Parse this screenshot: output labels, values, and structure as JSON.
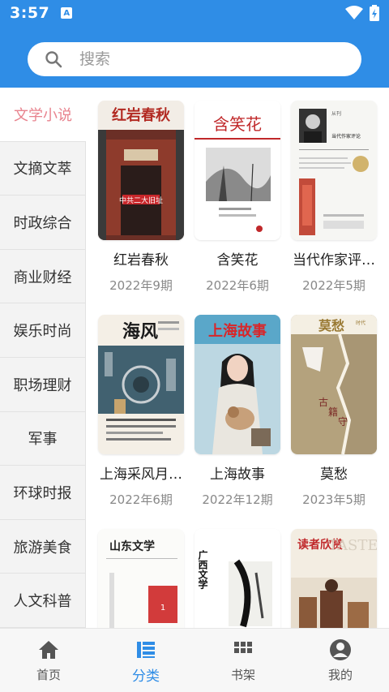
{
  "status": {
    "time": "3:57",
    "app_badge": "A"
  },
  "search": {
    "placeholder": "搜索"
  },
  "sidebar": {
    "items": [
      {
        "label": "文学小说",
        "active": true
      },
      {
        "label": "文摘文萃"
      },
      {
        "label": "时政综合"
      },
      {
        "label": "商业财经"
      },
      {
        "label": "娱乐时尚"
      },
      {
        "label": "职场理财"
      },
      {
        "label": "军事"
      },
      {
        "label": "环球时报"
      },
      {
        "label": "旅游美食"
      },
      {
        "label": "人文科普"
      }
    ]
  },
  "magazines": [
    {
      "title": "红岩春秋",
      "date": "2022年9期",
      "cover_heading": "红岩春秋",
      "cover_caption": "中共二大旧址"
    },
    {
      "title": "含笑花",
      "date": "2022年6期",
      "cover_heading": "含笑花"
    },
    {
      "title": "当代作家评…",
      "date": "2022年5期",
      "cover_heading": "当代作家评论"
    },
    {
      "title": "上海采风月…",
      "date": "2022年6期",
      "cover_heading": "海风"
    },
    {
      "title": "上海故事",
      "date": "2022年12期",
      "cover_heading": "上海故事"
    },
    {
      "title": "莫愁",
      "date": "2023年5期",
      "cover_heading": "莫愁"
    },
    {
      "title": "山东文学",
      "cover_heading": "山东文学"
    },
    {
      "title": "广西文学",
      "cover_heading": "广西文学"
    },
    {
      "title": "读者欣赏",
      "cover_heading": "读者欣赏"
    }
  ],
  "tabs": [
    {
      "label": "首页",
      "icon": "home-icon"
    },
    {
      "label": "分类",
      "icon": "category-icon",
      "active": true
    },
    {
      "label": "书架",
      "icon": "grid-icon"
    },
    {
      "label": "我的",
      "icon": "user-icon"
    }
  ],
  "colors": {
    "primary": "#2f8de6",
    "active_category": "#e8838e"
  }
}
